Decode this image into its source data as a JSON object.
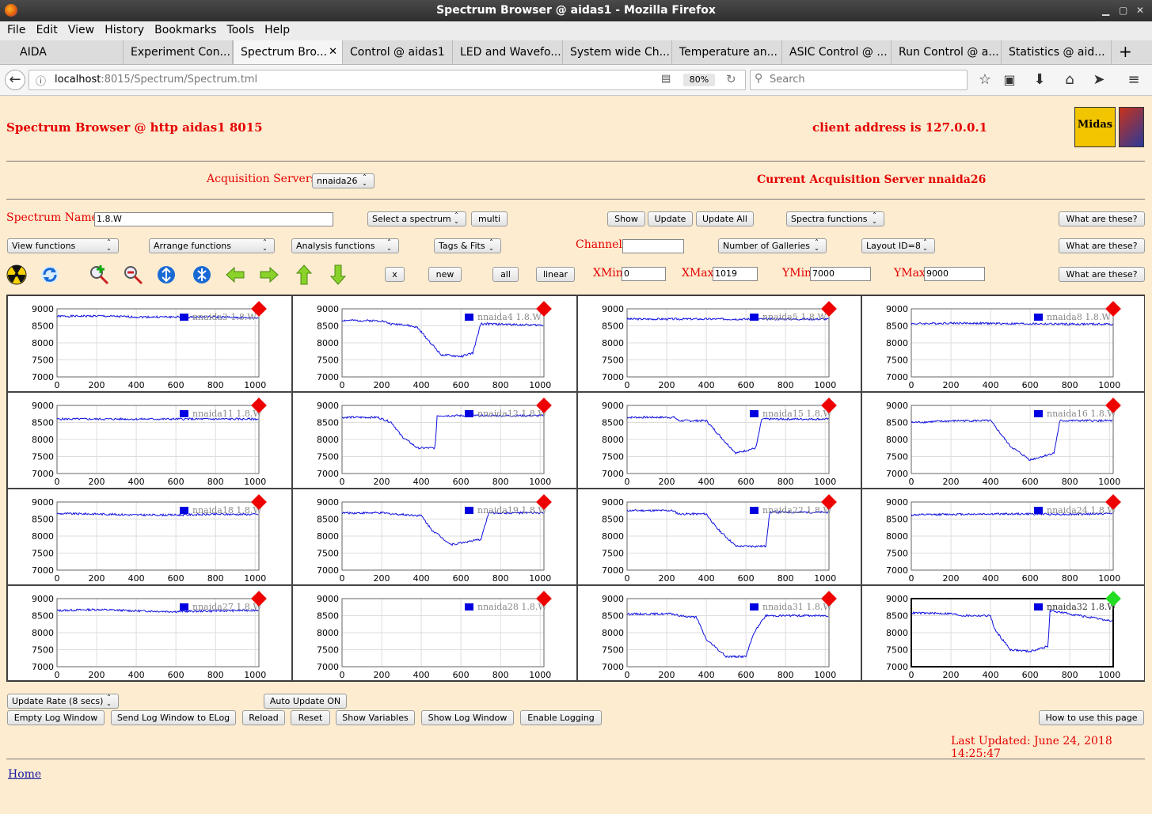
{
  "window": {
    "title": "Spectrum Browser @ aidas1 - Mozilla Firefox"
  },
  "menu": [
    "File",
    "Edit",
    "View",
    "History",
    "Bookmarks",
    "Tools",
    "Help"
  ],
  "tabs": [
    "AIDA",
    "Experiment Con...",
    "Spectrum Bro...",
    "Control @ aidas1",
    "LED and Wavefo...",
    "System wide Ch...",
    "Temperature an...",
    "ASIC Control @ ...",
    "Run Control @ a...",
    "Statistics @ aid..."
  ],
  "nav": {
    "url_host": "localhost",
    "url_rest": ":8015/Spectrum/Spectrum.tml",
    "zoom": "80%",
    "search_placeholder": "Search"
  },
  "header": {
    "title": "Spectrum Browser @ http aidas1 8015",
    "client": "client address is 127.0.0.1",
    "logo_midas": "Midas"
  },
  "acq": {
    "label": "Acquisition Servers",
    "server_value": "nnaida26",
    "current": "Current Acquisition Server nnaida26"
  },
  "row1": {
    "spectrum_label": "Spectrum Name:",
    "spectrum_value": "1.8.W",
    "select_spectrum": "Select a spectrum",
    "multi": "multi",
    "show": "Show",
    "update": "Update",
    "update_all": "Update All",
    "spectra_functions": "Spectra functions",
    "what1": "What are these?"
  },
  "row2": {
    "view": "View functions",
    "arrange": "Arrange functions",
    "analysis": "Analysis functions",
    "tags": "Tags & Fits",
    "channel_label": "Channel:",
    "channel_value": "",
    "galleries": "Number of Galleries",
    "layout": "Layout ID=8",
    "what2": "What are these?"
  },
  "row3": {
    "x": "x",
    "new": "new",
    "all": "all",
    "linear": "linear",
    "xmin_label": "XMin",
    "xmin": "0",
    "xmax_label": "XMax",
    "xmax": "1019",
    "ymin_label": "YMin",
    "ymin": "7000",
    "ymax_label": "YMax",
    "ymax": "9000",
    "what3": "What are these?"
  },
  "icons": [
    "radiation-icon",
    "refresh-icon",
    "zoom-in-icon",
    "zoom-out-icon",
    "expand-vertical-icon",
    "compress-vertical-icon",
    "arrow-left-icon",
    "arrow-right-icon",
    "arrow-up-icon",
    "arrow-down-icon"
  ],
  "chart_data": [
    {
      "type": "line",
      "legend": "nnaida3 1.8.W",
      "xlim": [
        0,
        1019
      ],
      "ylim": [
        7000,
        9000
      ],
      "x": [
        0,
        200,
        400,
        600,
        800,
        1000
      ],
      "y": [
        8780,
        8790,
        8760,
        8760,
        8760,
        8730
      ],
      "status": "red"
    },
    {
      "type": "line",
      "legend": "nnaida4 1.8.W",
      "xlim": [
        0,
        1019
      ],
      "ylim": [
        7000,
        9000
      ],
      "x": [
        0,
        200,
        250,
        300,
        380,
        500,
        600,
        660,
        700,
        1000
      ],
      "y": [
        8660,
        8650,
        8550,
        8550,
        8450,
        7650,
        7600,
        7700,
        8560,
        8520
      ],
      "status": "red"
    },
    {
      "type": "line",
      "legend": "nnaida5 1.8.W",
      "xlim": [
        0,
        1019
      ],
      "ylim": [
        7000,
        9000
      ],
      "x": [
        0,
        200,
        400,
        600,
        800,
        1000
      ],
      "y": [
        8700,
        8700,
        8700,
        8700,
        8700,
        8700
      ],
      "status": "red"
    },
    {
      "type": "line",
      "legend": "nnaida8 1.8.W",
      "xlim": [
        0,
        1019
      ],
      "ylim": [
        7000,
        9000
      ],
      "x": [
        0,
        200,
        400,
        600,
        800,
        1000
      ],
      "y": [
        8560,
        8580,
        8570,
        8560,
        8550,
        8550
      ],
      "status": "red"
    },
    {
      "type": "line",
      "legend": "nnaida11 1.8.W",
      "xlim": [
        0,
        1019
      ],
      "ylim": [
        7000,
        9000
      ],
      "x": [
        0,
        200,
        400,
        600,
        800,
        1000
      ],
      "y": [
        8600,
        8600,
        8600,
        8600,
        8600,
        8600
      ],
      "status": "red"
    },
    {
      "type": "line",
      "legend": "nnaida12 1.8.W",
      "xlim": [
        0,
        1019
      ],
      "ylim": [
        7000,
        9000
      ],
      "x": [
        0,
        180,
        250,
        300,
        380,
        470,
        480,
        600,
        1000
      ],
      "y": [
        8650,
        8650,
        8500,
        8100,
        7750,
        7750,
        8700,
        8700,
        8700
      ],
      "status": "red"
    },
    {
      "type": "line",
      "legend": "nnaida15 1.8.W",
      "xlim": [
        0,
        1019
      ],
      "ylim": [
        7000,
        9000
      ],
      "x": [
        0,
        240,
        260,
        400,
        500,
        550,
        650,
        680,
        1000
      ],
      "y": [
        8650,
        8650,
        8550,
        8550,
        7900,
        7600,
        7750,
        8600,
        8600
      ],
      "status": "red"
    },
    {
      "type": "line",
      "legend": "nnaida16 1.8.W",
      "xlim": [
        0,
        1019
      ],
      "ylim": [
        7000,
        9000
      ],
      "x": [
        0,
        240,
        260,
        400,
        500,
        600,
        720,
        750,
        1000
      ],
      "y": [
        8500,
        8550,
        8550,
        8550,
        7800,
        7400,
        7600,
        8550,
        8550
      ],
      "status": "red"
    },
    {
      "type": "line",
      "legend": "nnaida18 1.8.W",
      "xlim": [
        0,
        1019
      ],
      "ylim": [
        7000,
        9000
      ],
      "x": [
        0,
        200,
        400,
        600,
        800,
        1000
      ],
      "y": [
        8660,
        8650,
        8620,
        8620,
        8640,
        8640
      ],
      "status": "red"
    },
    {
      "type": "line",
      "legend": "nnaida19 1.8.W",
      "xlim": [
        0,
        1019
      ],
      "ylim": [
        7000,
        9000
      ],
      "x": [
        0,
        200,
        260,
        400,
        450,
        550,
        700,
        740,
        1000
      ],
      "y": [
        8680,
        8680,
        8650,
        8600,
        8200,
        7750,
        7900,
        8680,
        8680
      ],
      "status": "red"
    },
    {
      "type": "line",
      "legend": "nnaida22 1.8.W",
      "xlim": [
        0,
        1019
      ],
      "ylim": [
        7000,
        9000
      ],
      "x": [
        0,
        230,
        260,
        400,
        450,
        550,
        700,
        720,
        1000
      ],
      "y": [
        8750,
        8750,
        8650,
        8650,
        8250,
        7700,
        7700,
        8700,
        8700
      ],
      "status": "red"
    },
    {
      "type": "line",
      "legend": "nnaida24 1.8.W",
      "xlim": [
        0,
        1019
      ],
      "ylim": [
        7000,
        9000
      ],
      "x": [
        0,
        200,
        400,
        600,
        800,
        1000
      ],
      "y": [
        8620,
        8640,
        8650,
        8650,
        8640,
        8660
      ],
      "status": "red"
    },
    {
      "type": "line",
      "legend": "nnaida27 1.8.W",
      "xlim": [
        0,
        1019
      ],
      "ylim": [
        7000,
        9000
      ],
      "x": [
        0,
        200,
        400,
        600,
        800,
        1000
      ],
      "y": [
        8650,
        8680,
        8640,
        8620,
        8640,
        8660
      ],
      "status": "red"
    },
    {
      "type": "line",
      "legend": "nnaida28 1.8.W",
      "xlim": [
        0,
        1019
      ],
      "ylim": [
        7000,
        9000
      ],
      "x": [],
      "y": [],
      "status": "red"
    },
    {
      "type": "line",
      "legend": "nnaida31 1.8.W",
      "xlim": [
        0,
        1019
      ],
      "ylim": [
        7000,
        9000
      ],
      "x": [
        0,
        230,
        260,
        350,
        400,
        500,
        600,
        640,
        700,
        1000
      ],
      "y": [
        8550,
        8550,
        8500,
        8450,
        7800,
        7300,
        7300,
        8000,
        8500,
        8500
      ],
      "status": "red"
    },
    {
      "type": "line",
      "legend": "nnaida32 1.8.W",
      "xlim": [
        0,
        1019
      ],
      "ylim": [
        7000,
        9000
      ],
      "x": [
        0,
        200,
        260,
        400,
        420,
        500,
        600,
        690,
        700,
        1000
      ],
      "y": [
        8580,
        8560,
        8500,
        8500,
        8100,
        7500,
        7450,
        7600,
        8650,
        8350
      ],
      "status": "green"
    }
  ],
  "axis": {
    "yticks": [
      "9000",
      "8500",
      "8000",
      "7500",
      "7000"
    ],
    "xticks": [
      "0",
      "200",
      "400",
      "600",
      "800",
      "1000"
    ]
  },
  "footer": {
    "update_rate": "Update Rate (8 secs)",
    "auto_update": "Auto Update ON",
    "empty_log": "Empty Log Window",
    "send_log": "Send Log Window to ELog",
    "reload": "Reload",
    "reset": "Reset",
    "show_vars": "Show Variables",
    "show_log": "Show Log Window",
    "enable_logging": "Enable Logging",
    "howto": "How to use this page",
    "last_updated": "Last Updated: June 24, 2018 14:25:47",
    "home": "Home"
  }
}
